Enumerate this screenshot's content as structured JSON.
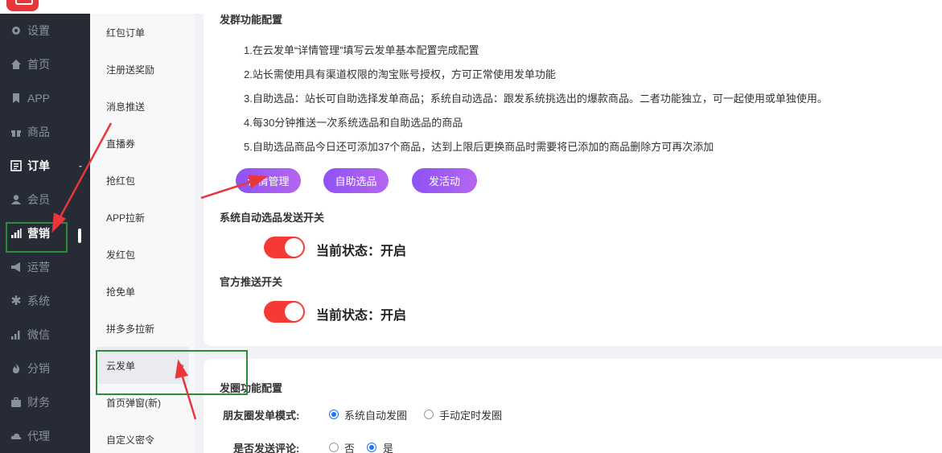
{
  "sidebar": {
    "items": [
      {
        "label": "设置",
        "icon": "gear-icon"
      },
      {
        "label": "首页",
        "icon": "home-icon"
      },
      {
        "label": "APP",
        "icon": "bookmark-icon"
      },
      {
        "label": "商品",
        "icon": "gift-icon"
      },
      {
        "label": "订单",
        "icon": "list-icon",
        "collapse": "-"
      },
      {
        "label": "会员",
        "icon": "user-icon"
      },
      {
        "label": "营销",
        "icon": "bar-chart-icon"
      },
      {
        "label": "运营",
        "icon": "megaphone-icon"
      },
      {
        "label": "系统",
        "icon": "asterisk-icon"
      },
      {
        "label": "微信",
        "icon": "signal-icon"
      },
      {
        "label": "分销",
        "icon": "fire-icon"
      },
      {
        "label": "财务",
        "icon": "briefcase-icon"
      },
      {
        "label": "代理",
        "icon": "cloud-icon"
      }
    ]
  },
  "submenu": {
    "items": [
      {
        "label": "红包订单"
      },
      {
        "label": "注册送奖励"
      },
      {
        "label": "消息推送"
      },
      {
        "label": "直播券"
      },
      {
        "label": "抢红包"
      },
      {
        "label": "APP拉新"
      },
      {
        "label": "发红包"
      },
      {
        "label": "抢免单"
      },
      {
        "label": "拼多多拉新"
      },
      {
        "label": "云发单",
        "chevron": ">"
      },
      {
        "label": "首页弹窗(新)"
      },
      {
        "label": "自定义密令"
      }
    ]
  },
  "group_config": {
    "title": "发群功能配置",
    "notes": [
      "1.在云发单“详情管理”填写云发单基本配置完成配置",
      "2.站长需使用具有渠道权限的淘宝账号授权，方可正常使用发单功能",
      "3.自助选品：站长可自助选择发单商品；系统自动选品：跟发系统挑选出的爆款商品。二者功能独立，可一起使用或单独使用。",
      "4.每30分钟推送一次系统选品和自助选品的商品",
      "5.自助选品商品今日还可添加37个商品，达到上限后更换商品时需要将已添加的商品删除方可再次添加"
    ],
    "buttons": {
      "detail": "详情管理",
      "self_select": "自助选品",
      "campaign": "发活动"
    },
    "auto_switch": {
      "title": "系统自动选品发送开关",
      "state_text": "当前状态：开启"
    },
    "official_switch": {
      "title": "官方推送开关",
      "state_text": "当前状态：开启"
    }
  },
  "moments_config": {
    "title": "发圈功能配置",
    "mode": {
      "label": "朋友圈发单模式:",
      "options": [
        "系统自动发圈",
        "手动定时发圈"
      ],
      "selected": "系统自动发圈"
    },
    "comment": {
      "label": "是否发送评论:",
      "options": [
        "否",
        "是"
      ],
      "selected": "是"
    }
  },
  "colors": {
    "sidebar_bg": "#262b36",
    "accent_purple": "#9a5cf5",
    "toggle_red": "#f53a36",
    "radio_blue": "#1677ff",
    "annotation_red": "#e8363b",
    "annotation_green": "#2e8b3a"
  }
}
